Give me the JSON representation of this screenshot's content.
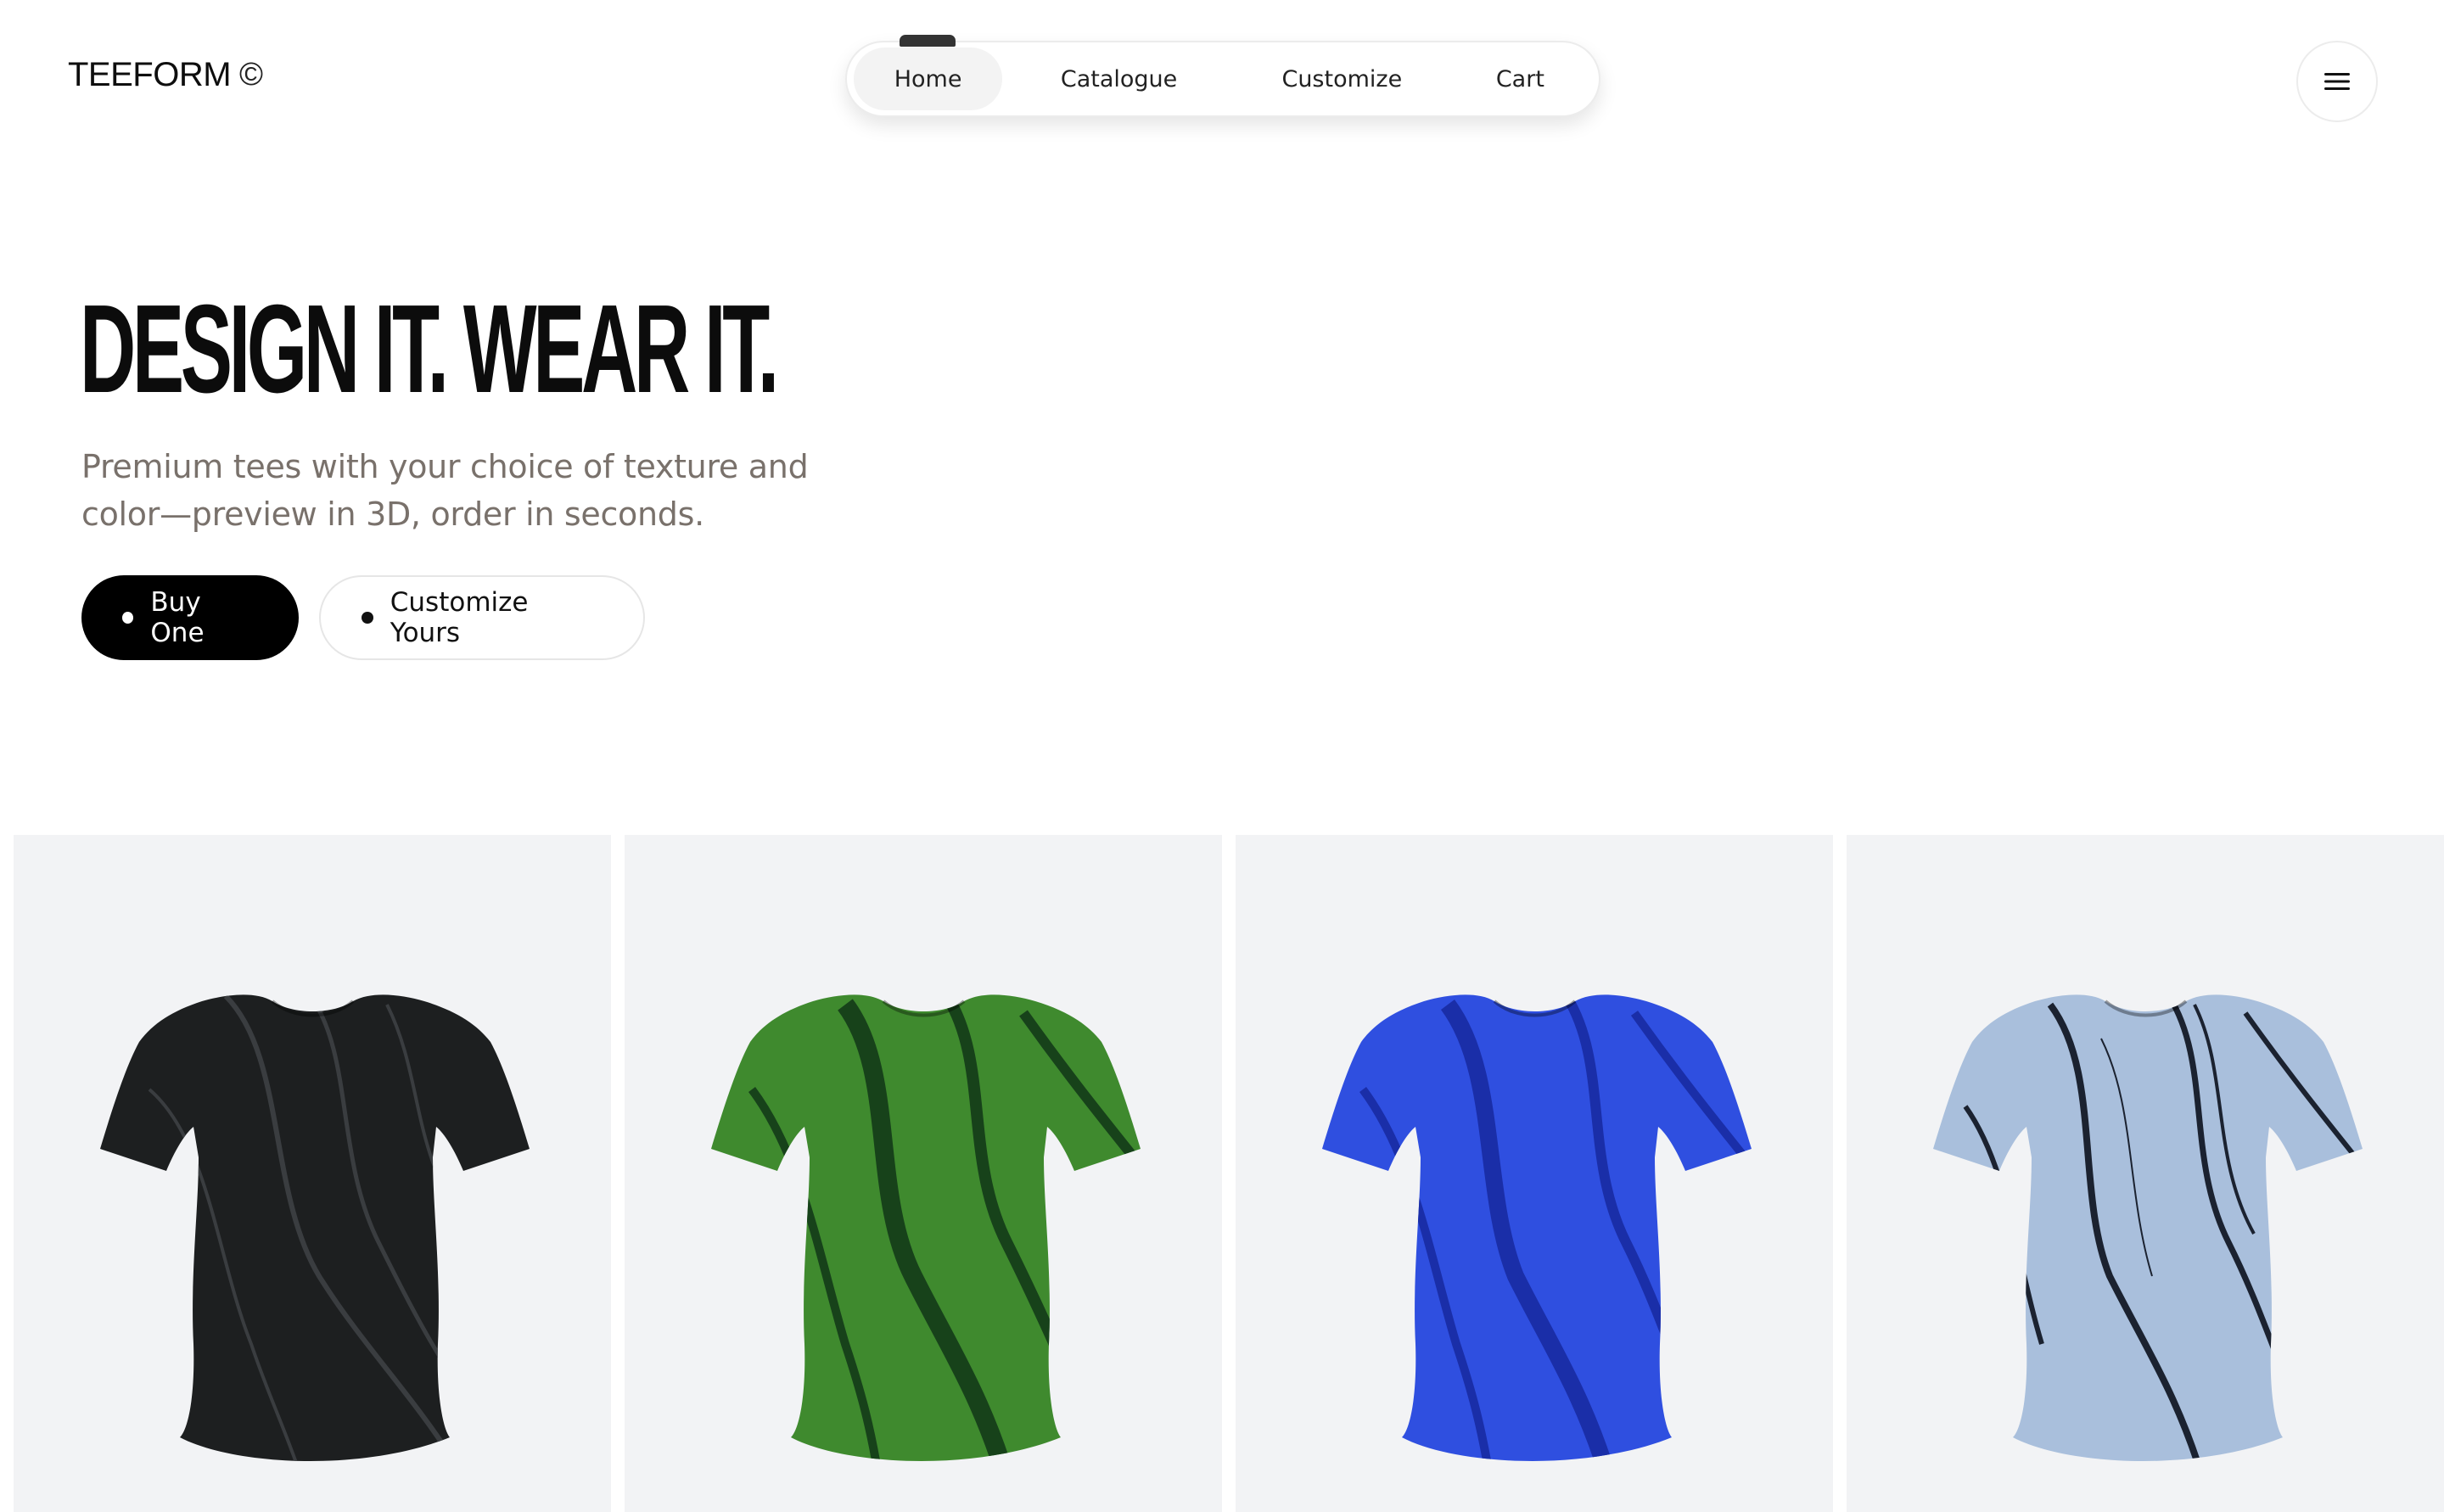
{
  "brand": {
    "name": "TEEFORM",
    "mark": "©"
  },
  "nav": {
    "items": [
      {
        "label": "Home",
        "active": true
      },
      {
        "label": "Catalogue",
        "active": false
      },
      {
        "label": "Customize",
        "active": false
      },
      {
        "label": "Cart",
        "active": false
      }
    ]
  },
  "menu": {
    "icon": "hamburger-menu-icon"
  },
  "hero": {
    "title": "DESIGN IT. WEAR IT.",
    "subtitle_line1": "Premium tees with your choice of texture and",
    "subtitle_line2": "color—preview in 3D, order in seconds.",
    "primary_button": "Buy One",
    "secondary_button": "Customize Yours"
  },
  "products": [
    {
      "name": "black-marble-tee",
      "base": "#1d1f20",
      "stripe": "#3a3d40"
    },
    {
      "name": "green-marble-tee",
      "base": "#3f8a2e",
      "stripe": "#17421a"
    },
    {
      "name": "blue-marble-tee",
      "base": "#2f4fe0",
      "stripe": "#1a2ea8"
    },
    {
      "name": "lightblue-marble-tee",
      "base": "#a9bfdc",
      "stripe": "#1b2230"
    }
  ],
  "colors": {
    "accent": "#000000",
    "card_bg": "#f2f3f5",
    "muted_text": "#79716b"
  }
}
